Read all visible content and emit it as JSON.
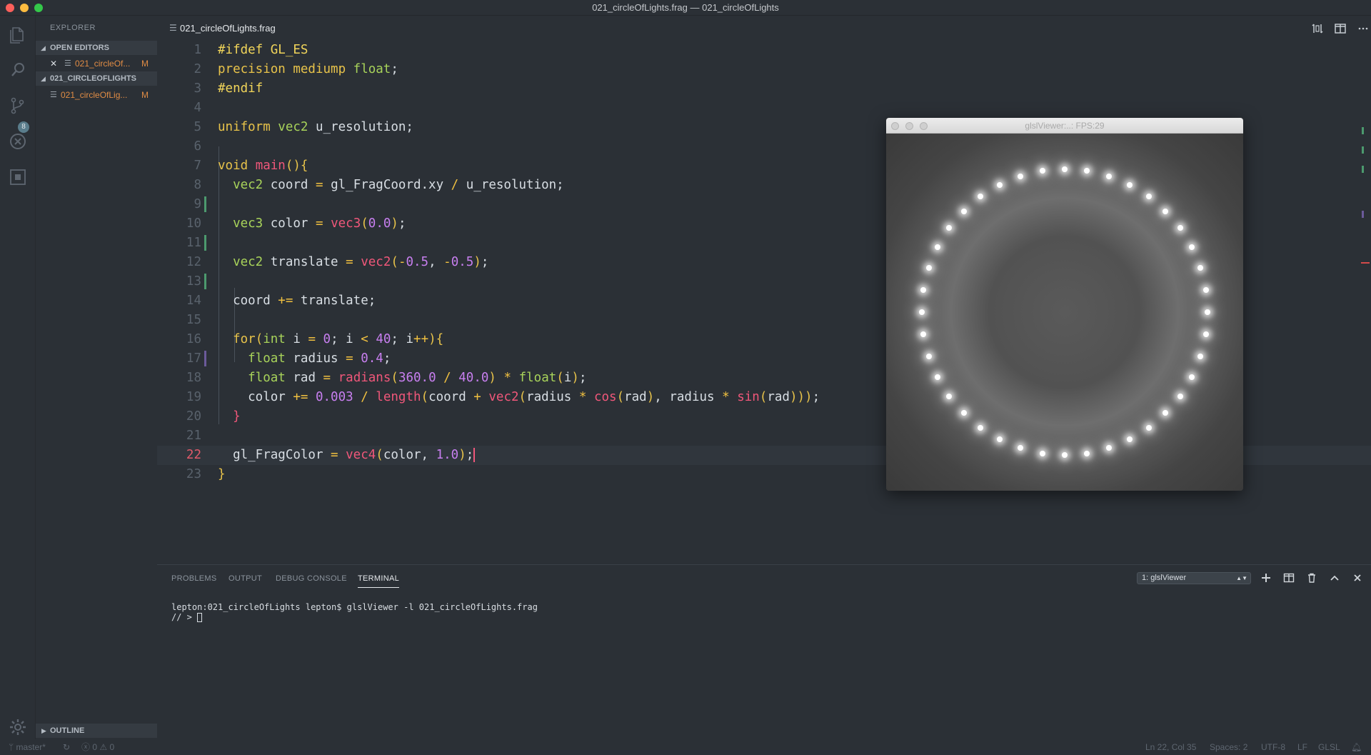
{
  "window": {
    "title": "021_circleOfLights.frag — 021_circleOfLights"
  },
  "activity": {
    "icons": [
      "files-icon",
      "search-icon",
      "source-control-icon",
      "debug-icon",
      "extensions-icon",
      "settings-gear-icon"
    ],
    "scm_badge": "8"
  },
  "sidebar": {
    "title": "EXPLORER",
    "open_editors_label": "OPEN EDITORS",
    "open_editors": [
      {
        "name": "021_circleOf...",
        "status": "M"
      }
    ],
    "folder_label": "021_CIRCLEOFLIGHTS",
    "files": [
      {
        "name": "021_circleOfLig...",
        "status": "M"
      }
    ],
    "outline_label": "OUTLINE"
  },
  "tab": {
    "label": "021_circleOfLights.frag"
  },
  "editor": {
    "current_line": 22,
    "lines": [
      {
        "n": "1",
        "text": "#ifdef GL_ES"
      },
      {
        "n": "2",
        "text": "precision mediump float;"
      },
      {
        "n": "3",
        "text": "#endif"
      },
      {
        "n": "4",
        "text": ""
      },
      {
        "n": "5",
        "text": "uniform vec2 u_resolution;"
      },
      {
        "n": "6",
        "text": ""
      },
      {
        "n": "7",
        "text": "void main(){"
      },
      {
        "n": "8",
        "text": "  vec2 coord = gl_FragCoord.xy / u_resolution;"
      },
      {
        "n": "9",
        "text": ""
      },
      {
        "n": "10",
        "text": "  vec3 color = vec3(0.0);"
      },
      {
        "n": "11",
        "text": ""
      },
      {
        "n": "12",
        "text": "  vec2 translate = vec2(-0.5, -0.5);"
      },
      {
        "n": "13",
        "text": ""
      },
      {
        "n": "14",
        "text": "  coord += translate;"
      },
      {
        "n": "15",
        "text": ""
      },
      {
        "n": "16",
        "text": "  for(int i = 0; i < 40; i++){"
      },
      {
        "n": "17",
        "text": "    float radius = 0.4;"
      },
      {
        "n": "18",
        "text": "    float rad = radians(360.0 / 40.0) * float(i);"
      },
      {
        "n": "19",
        "text": "    color += 0.003 / length(coord + vec2(radius * cos(rad), radius * sin(rad)));"
      },
      {
        "n": "20",
        "text": "  }"
      },
      {
        "n": "21",
        "text": ""
      },
      {
        "n": "22",
        "text": "  gl_FragColor = vec4(color, 1.0);"
      },
      {
        "n": "23",
        "text": "}"
      }
    ]
  },
  "viewer": {
    "title": "glslViewer:..: FPS:29",
    "light_count": 40,
    "ring_radius": 0.4
  },
  "panel": {
    "tabs": [
      "PROBLEMS",
      "OUTPUT",
      "DEBUG CONSOLE",
      "TERMINAL"
    ],
    "active_tab": "TERMINAL",
    "terminal_select": "1: glslViewer",
    "terminal_lines": [
      "lepton:021_circleOfLights lepton$ glslViewer -l 021_circleOfLights.frag",
      "// > "
    ]
  },
  "status": {
    "branch": "master*",
    "errors": "0",
    "warnings": "0",
    "position": "Ln 22, Col 35",
    "spaces": "Spaces: 2",
    "encoding": "UTF-8",
    "eol": "LF",
    "language": "GLSL"
  },
  "colors": {
    "background": "#2b3036",
    "modified": "#e08c45",
    "type": "#a8d35a",
    "keyword": "#e8c34a",
    "function": "#f0577a",
    "number": "#c87ff0"
  }
}
